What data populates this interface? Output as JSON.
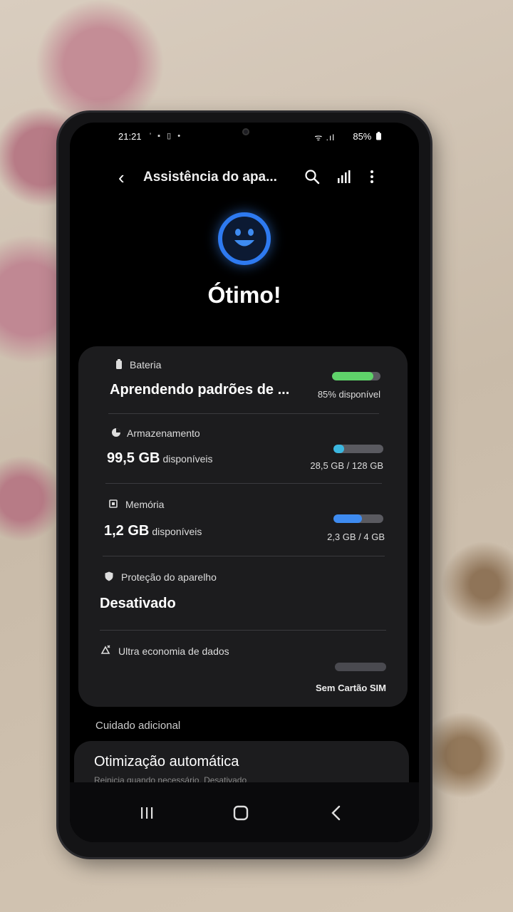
{
  "status": {
    "time": "21:21",
    "left_icons": "' ▪ ▯ •",
    "signal": "ᯤ .ıl",
    "battery": "85%"
  },
  "header": {
    "back_icon": "chevron-left-icon",
    "title": "Assistência do apa...",
    "search_icon": "search-icon",
    "stats_icon": "bar-chart-icon",
    "more_icon": "more-vertical-icon"
  },
  "hero": {
    "icon": "smiley-face-icon",
    "status": "Ótimo!",
    "accent": "#2e7af0"
  },
  "items": {
    "battery": {
      "label": "Bateria",
      "value": "Aprendendo padrões de ...",
      "info": "85% disponível",
      "level": 0.85,
      "color": "#5fd36a"
    },
    "storage": {
      "label": "Armazenamento",
      "value": "99,5 GB",
      "value_suffix": "disponíveis",
      "info": "28,5 GB / 128 GB",
      "level": 0.22,
      "color": "#3bb7e0"
    },
    "memory": {
      "label": "Memória",
      "value": "1,2 GB",
      "value_suffix": "disponíveis",
      "info": "2,3 GB / 4 GB",
      "level": 0.575,
      "color": "#3e8bf0"
    },
    "protection": {
      "label": "Proteção do aparelho",
      "value": "Desativado"
    },
    "data_saver": {
      "label": "Ultra economia de dados",
      "info": "Sem Cartão SIM",
      "level": 0
    }
  },
  "additional": {
    "section_label": "Cuidado adicional",
    "auto_opt_title": "Otimização automática",
    "auto_opt_sub": "Reinicia quando necessário. Desativado"
  },
  "navbar": {
    "recents_icon": "recent-apps-icon",
    "home_icon": "home-icon",
    "back_icon": "back-icon"
  }
}
